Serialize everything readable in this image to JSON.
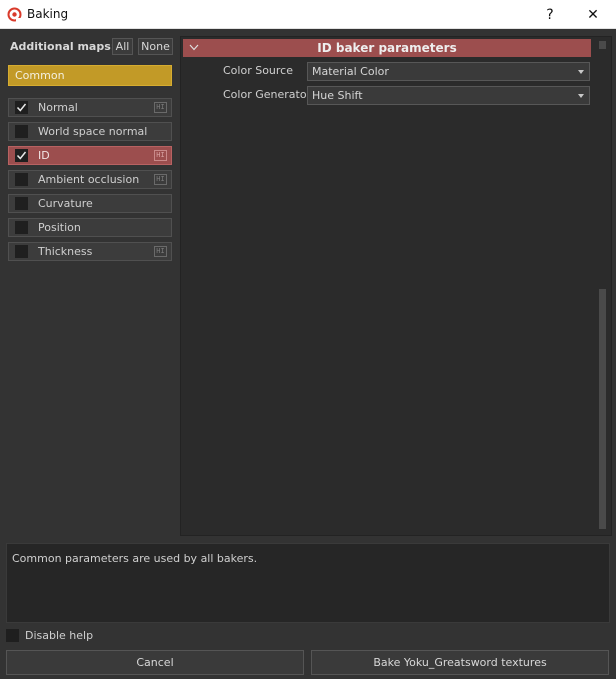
{
  "window": {
    "title": "Baking",
    "help_glyph": "?",
    "close_glyph": "✕",
    "app_icon": "substance-logo-icon"
  },
  "left_panel": {
    "additional_maps_label": "Additional maps:",
    "all_label": "All",
    "none_label": "None",
    "common_label": "Common",
    "bakers": [
      {
        "label": "Normal",
        "checked": true,
        "selected": false,
        "has_hi_icon": true
      },
      {
        "label": "World space normal",
        "checked": false,
        "selected": false,
        "has_hi_icon": false
      },
      {
        "label": "ID",
        "checked": true,
        "selected": true,
        "has_hi_icon": true
      },
      {
        "label": "Ambient occlusion",
        "checked": false,
        "selected": false,
        "has_hi_icon": true
      },
      {
        "label": "Curvature",
        "checked": false,
        "selected": false,
        "has_hi_icon": false
      },
      {
        "label": "Position",
        "checked": false,
        "selected": false,
        "has_hi_icon": false
      },
      {
        "label": "Thickness",
        "checked": false,
        "selected": false,
        "has_hi_icon": true
      }
    ],
    "hi_icon_text": "HI"
  },
  "right_panel": {
    "section_title": "ID baker parameters",
    "params": [
      {
        "label": "Color Source",
        "value": "Material Color"
      },
      {
        "label": "Color Generator",
        "value": "Hue Shift"
      }
    ]
  },
  "help": {
    "text": "Common parameters are used by all bakers.",
    "disable_help_label": "Disable help",
    "disable_help_checked": false
  },
  "footer": {
    "cancel_label": "Cancel",
    "bake_label": "Bake Yoku_Greatsword textures"
  },
  "colors": {
    "common_accent": "#c29a27",
    "selected_accent": "#9c4e4e",
    "background": "#333333"
  }
}
